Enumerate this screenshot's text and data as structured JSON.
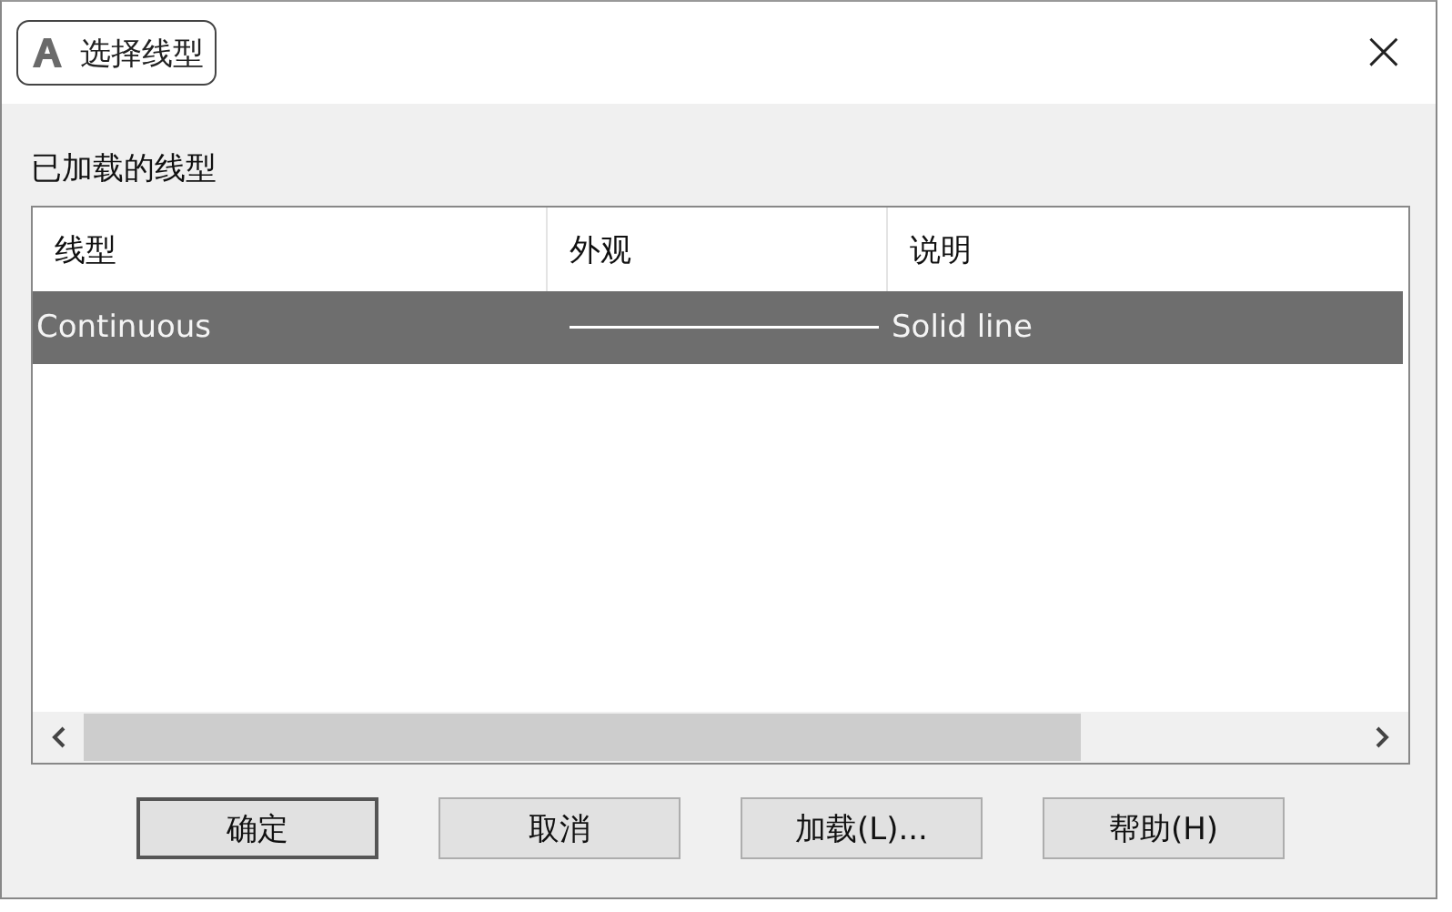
{
  "window": {
    "title": "选择线型",
    "close": "×"
  },
  "section_label": "已加载的线型",
  "table": {
    "columns": [
      "线型",
      "外观",
      "说明"
    ],
    "rows": [
      {
        "linetype": "Continuous",
        "kind": "solid",
        "description": "Solid line",
        "selected": true
      }
    ]
  },
  "buttons": [
    {
      "label": "确定",
      "default": true
    },
    {
      "label": "取消",
      "default": false
    },
    {
      "label": "加载(L)...",
      "default": false
    },
    {
      "label": "帮助(H)",
      "default": false
    }
  ]
}
